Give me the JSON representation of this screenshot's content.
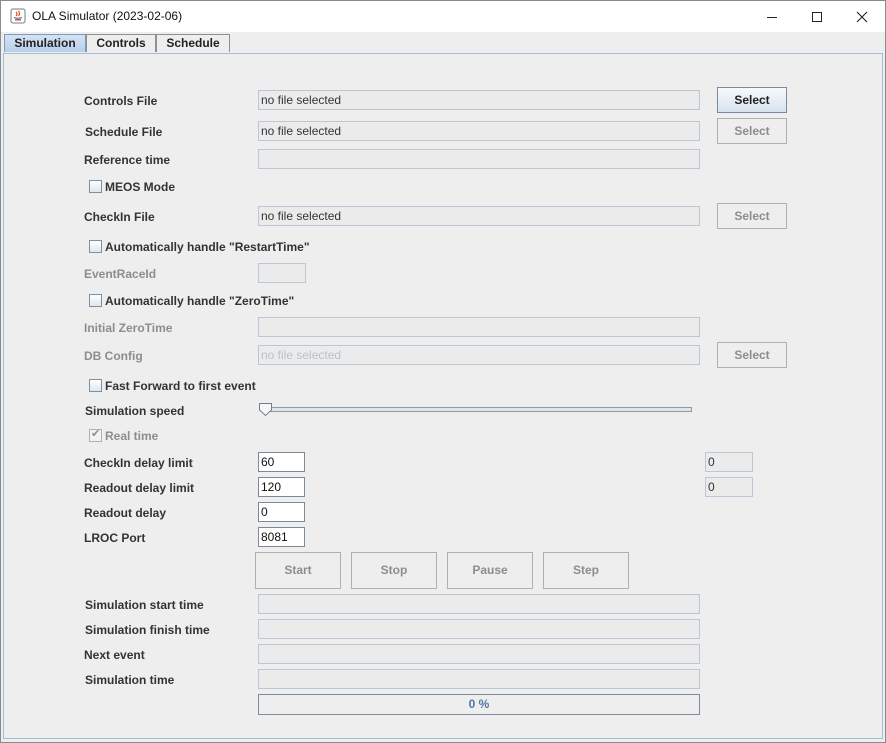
{
  "window": {
    "title": "OLA Simulator (2023-02-06)"
  },
  "tabs": [
    {
      "label": "Simulation",
      "active": true
    },
    {
      "label": "Controls"
    },
    {
      "label": "Schedule"
    }
  ],
  "form": {
    "controls_file": {
      "label": "Controls File",
      "value": "no file selected",
      "button": "Select"
    },
    "schedule_file": {
      "label": "Schedule File",
      "value": "no file selected",
      "button": "Select"
    },
    "reference_time": {
      "label": "Reference time",
      "value": ""
    },
    "meos_mode": {
      "label": "MEOS Mode",
      "checked": false
    },
    "checkin_file": {
      "label": "CheckIn File",
      "value": "no file selected",
      "button": "Select"
    },
    "auto_restart": {
      "label": "Automatically handle \"RestartTime\"",
      "checked": false
    },
    "event_race_id": {
      "label": "EventRaceId",
      "value": ""
    },
    "auto_zero": {
      "label": "Automatically handle \"ZeroTime\"",
      "checked": false
    },
    "initial_zero_time": {
      "label": "Initial ZeroTime",
      "value": ""
    },
    "db_config": {
      "label": "DB Config",
      "value": "no file selected",
      "button": "Select"
    },
    "fast_forward": {
      "label": "Fast Forward to first event",
      "checked": false
    },
    "simulation_speed": {
      "label": "Simulation speed",
      "value_fraction": 0.0
    },
    "real_time": {
      "label": "Real time",
      "checked": true
    },
    "checkin_delay": {
      "label": "CheckIn delay limit",
      "value": "60",
      "status": "0"
    },
    "readout_delay_limit": {
      "label": "Readout delay limit",
      "value": "120",
      "status": "0"
    },
    "readout_delay": {
      "label": "Readout delay",
      "value": "0"
    },
    "lroc_port": {
      "label": "LROC Port",
      "value": "8081"
    }
  },
  "actions": {
    "start": "Start",
    "stop": "Stop",
    "pause": "Pause",
    "step": "Step"
  },
  "status": {
    "start_time": {
      "label": "Simulation start time",
      "value": ""
    },
    "finish_time": {
      "label": "Simulation finish time",
      "value": ""
    },
    "next_event": {
      "label": "Next event",
      "value": ""
    },
    "sim_time": {
      "label": "Simulation time",
      "value": ""
    },
    "progress": {
      "label": "0 %",
      "value_fraction": 0.0
    }
  }
}
